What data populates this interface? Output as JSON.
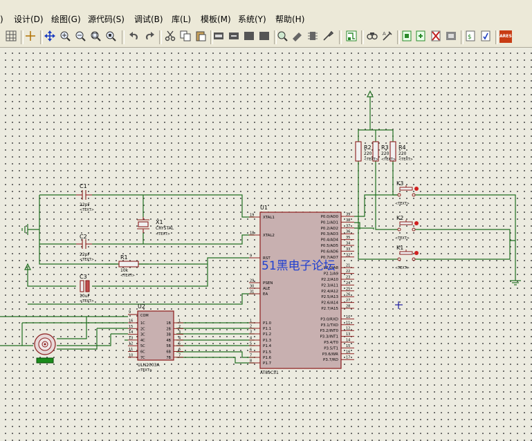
{
  "menu": {
    "items": [
      "设计(D)",
      "绘图(G)",
      "源代码(S)",
      "调试(B)",
      "库(L)",
      "模板(M)",
      "系统(Y)",
      "帮助(H)"
    ],
    "leading_fragment": ")"
  },
  "toolbar": {
    "icons": [
      "grid-icon",
      "origin-icon",
      "pan-icon",
      "zoom-in-icon",
      "zoom-out-icon",
      "zoom-all-icon",
      "zoom-area-icon",
      "undo-icon",
      "redo-icon",
      "cut-icon",
      "copy-icon",
      "paste-icon",
      "block-copy-icon",
      "block-move-icon",
      "block-rotate-icon",
      "block-delete-icon",
      "pick-device-icon",
      "make-device-icon",
      "package-icon",
      "decompose-icon",
      "wire-autorouter-icon",
      "search-icon",
      "property-assign-icon",
      "new-sheet-icon",
      "remove-sheet-icon",
      "zoom-child-icon",
      "bom-icon",
      "erc-icon",
      "ares-icon"
    ],
    "ares_label": "ARES"
  },
  "schematic": {
    "u1": {
      "ref": "U1",
      "part": "AT89C51",
      "left_pins": [
        {
          "num": "19",
          "name": "XTAL1"
        },
        {
          "num": "18",
          "name": "XTAL2"
        },
        {
          "num": "9",
          "name": "RST"
        },
        {
          "num": "29",
          "name": "PSEN"
        },
        {
          "num": "30",
          "name": "ALE"
        },
        {
          "num": "31",
          "name": "EA"
        },
        {
          "num": "1",
          "name": "P1.0"
        },
        {
          "num": "2",
          "name": "P1.1"
        },
        {
          "num": "3",
          "name": "P1.2"
        },
        {
          "num": "4",
          "name": "P1.3"
        },
        {
          "num": "5",
          "name": "P1.4"
        },
        {
          "num": "6",
          "name": "P1.5"
        },
        {
          "num": "7",
          "name": "P1.6"
        },
        {
          "num": "8",
          "name": "P1.7"
        }
      ],
      "right_pins": [
        {
          "num": "39",
          "name": "P0.0/AD0"
        },
        {
          "num": "38",
          "name": "P0.1/AD1"
        },
        {
          "num": "37",
          "name": "P0.2/AD2"
        },
        {
          "num": "36",
          "name": "P0.3/AD3"
        },
        {
          "num": "35",
          "name": "P0.4/AD4"
        },
        {
          "num": "34",
          "name": "P0.5/AD5"
        },
        {
          "num": "33",
          "name": "P0.6/AD6"
        },
        {
          "num": "32",
          "name": "P0.7/AD7"
        },
        {
          "num": "21",
          "name": "P2.0/A8"
        },
        {
          "num": "22",
          "name": "P2.1/A9"
        },
        {
          "num": "23",
          "name": "P2.2/A10"
        },
        {
          "num": "24",
          "name": "P2.3/A11"
        },
        {
          "num": "25",
          "name": "P2.4/A12"
        },
        {
          "num": "26",
          "name": "P2.5/A13"
        },
        {
          "num": "27",
          "name": "P2.6/A14"
        },
        {
          "num": "28",
          "name": "P2.7/A15"
        },
        {
          "num": "10",
          "name": "P3.0/RXD"
        },
        {
          "num": "11",
          "name": "P3.1/TXD"
        },
        {
          "num": "12",
          "name": "P3.2/INT0"
        },
        {
          "num": "13",
          "name": "P3.3/INT1"
        },
        {
          "num": "14",
          "name": "P3.4/T0"
        },
        {
          "num": "15",
          "name": "P3.5/T1"
        },
        {
          "num": "16",
          "name": "P3.6/WR"
        },
        {
          "num": "17",
          "name": "P3.7/RD"
        }
      ]
    },
    "u2": {
      "ref": "U2",
      "part": "ULN2003A",
      "text": "<TEXT>",
      "com": "COM",
      "com_pin": "9",
      "in_pins": [
        {
          "num": "16",
          "name": "1C"
        },
        {
          "num": "15",
          "name": "2C"
        },
        {
          "num": "14",
          "name": "3C"
        },
        {
          "num": "13",
          "name": "4C"
        },
        {
          "num": "12",
          "name": "5C"
        },
        {
          "num": "11",
          "name": "6C"
        },
        {
          "num": "10",
          "name": "7C"
        }
      ],
      "out_pins": [
        {
          "num": "1",
          "name": "1B"
        },
        {
          "num": "2",
          "name": "2B"
        },
        {
          "num": "3",
          "name": "3B"
        },
        {
          "num": "4",
          "name": "4B"
        },
        {
          "num": "5",
          "name": "5B"
        },
        {
          "num": "6",
          "name": "6B"
        },
        {
          "num": "7",
          "name": "7B"
        }
      ]
    },
    "c1": {
      "ref": "C1",
      "value": "22pF",
      "text": "<TEXT>"
    },
    "c2": {
      "ref": "C2",
      "value": "22pF",
      "text": "<TEXT>"
    },
    "c3": {
      "ref": "C3",
      "value": "10uF",
      "text": "<TEXT>"
    },
    "x1": {
      "ref": "X1",
      "value": "CRYSTAL",
      "text": "<TEXT>"
    },
    "r1": {
      "ref": "R1",
      "value": "10k",
      "text": "<TEXT>"
    },
    "r2": {
      "ref": "R2",
      "value": "220",
      "text": "<TEXT>"
    },
    "r3": {
      "ref": "R3",
      "value": "220",
      "text": "<TEXT>"
    },
    "r4": {
      "ref": "R4",
      "value": "220",
      "text": "<TEXT>"
    },
    "k3": {
      "ref": "K3",
      "text": "<TEXT>"
    },
    "k2": {
      "ref": "K2",
      "text": "<TEXT>"
    },
    "k1": {
      "ref": "K1",
      "text": "<TEXT>"
    },
    "watermark": "51黑电子论坛"
  },
  "colors": {
    "wire": "#1f6e1f",
    "component": "#8b1c1c",
    "chip_fill": "#c8b0b0",
    "watermark": "#2040d0",
    "cursor": "#1a1aa0"
  }
}
